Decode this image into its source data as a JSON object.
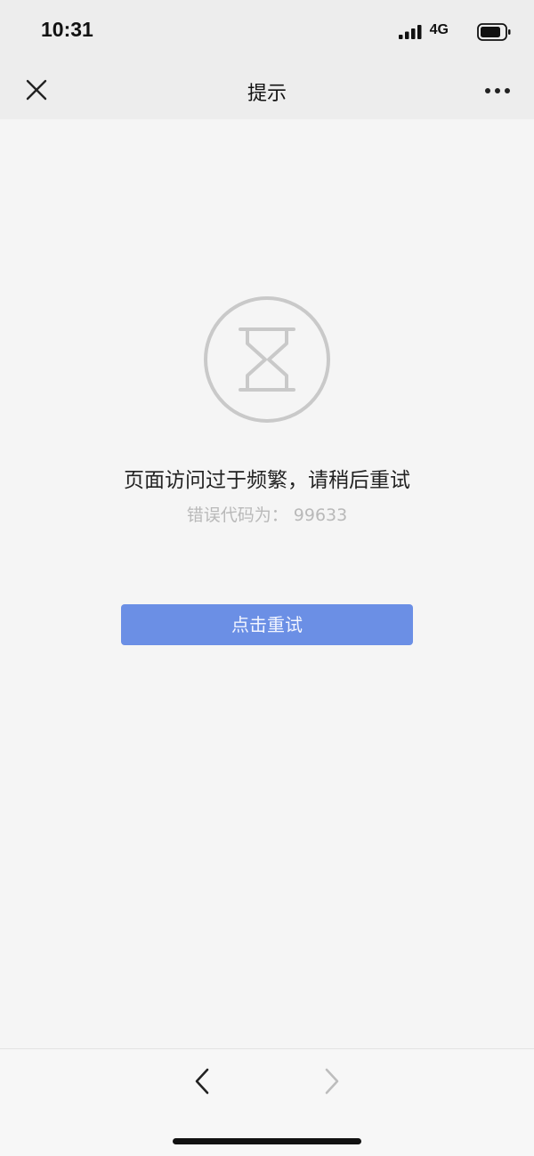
{
  "status_bar": {
    "time": "10:31",
    "network": "4G",
    "icons": [
      "signal-icon",
      "battery-icon"
    ]
  },
  "nav": {
    "title": "提示",
    "left_icon": "close-icon",
    "right_icon": "more-icon"
  },
  "main": {
    "icon": "hourglass-icon",
    "message": "页面访问过于频繁，请稍后重试",
    "error_code": "错误代码为：  99633",
    "retry_label": "点击重试"
  },
  "toolbar": {
    "back_icon": "back-icon",
    "forward_icon": "forward-icon"
  },
  "colors": {
    "accent": "#6b8fe5",
    "background": "#f5f5f5",
    "bar": "#ededed",
    "muted_text": "#b9b9b9"
  }
}
